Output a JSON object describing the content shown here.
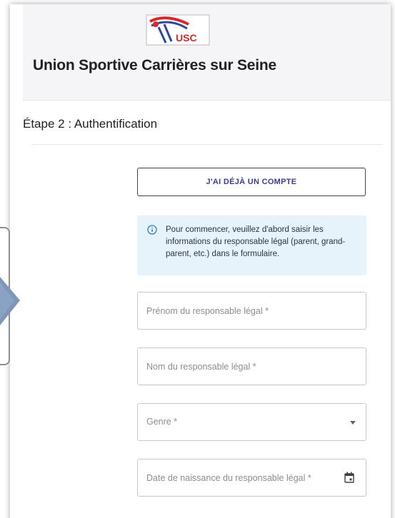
{
  "header": {
    "logo_text": "USC",
    "title": "Union Sportive Carrières sur Seine"
  },
  "step": {
    "title": "Étape 2 : Authentification"
  },
  "account_button": {
    "label": "J'AI DÉJÀ UN COMPTE"
  },
  "info_alert": {
    "icon": "info-icon",
    "text": "Pour commencer, veuillez d'abord saisir les informations du responsable légal (parent, grand-parent, etc.) dans le formulaire."
  },
  "form": {
    "first_name": {
      "placeholder": "Prénom du responsable légal *",
      "value": ""
    },
    "last_name": {
      "placeholder": "Nom du responsable légal *",
      "value": ""
    },
    "gender": {
      "placeholder": "Genre *",
      "icon": "chevron-down-icon"
    },
    "birth_date": {
      "placeholder": "Date de naissance du responsable légal *",
      "icon": "calendar-icon"
    }
  },
  "colors": {
    "header_bg": "#f5f5f7",
    "info_bg": "#e7f3fb",
    "button_text": "#3a3f8f",
    "overlay_arrow": "#7e97b8",
    "logo_red": "#d42a2a",
    "logo_blue": "#2c4a9a"
  }
}
